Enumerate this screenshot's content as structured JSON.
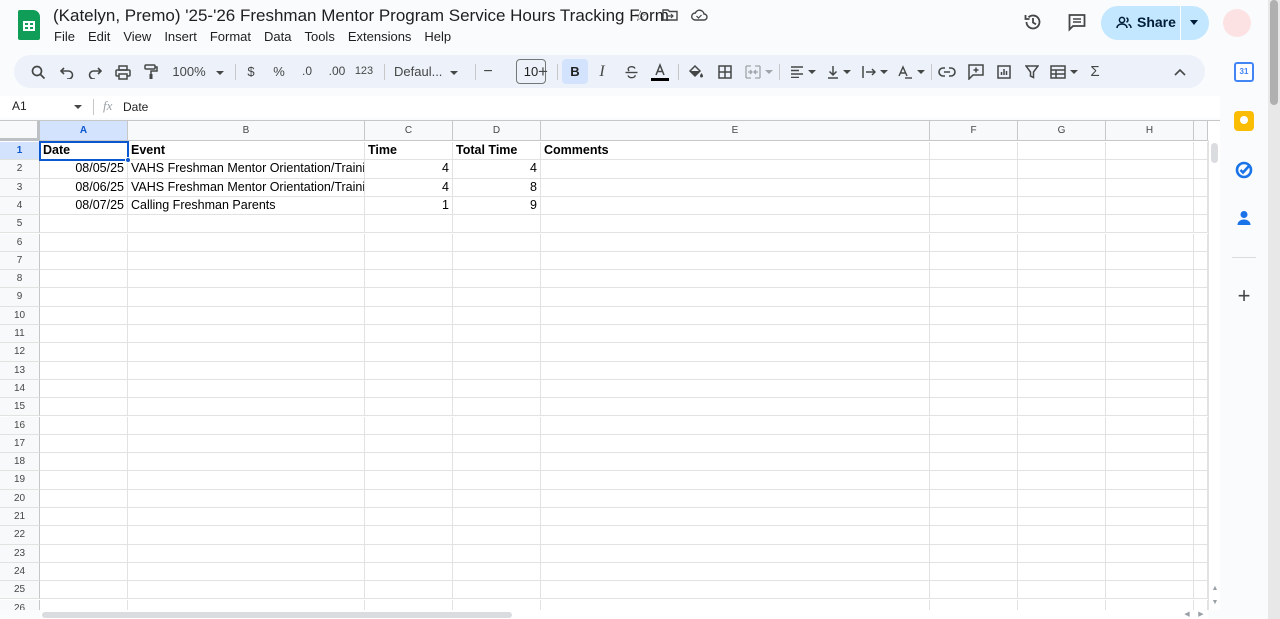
{
  "document": {
    "title": "(Katelyn, Premo) '25-'26 Freshman Mentor Program Service Hours Tracking Form"
  },
  "menu": [
    "File",
    "Edit",
    "View",
    "Insert",
    "Format",
    "Data",
    "Tools",
    "Extensions",
    "Help"
  ],
  "header": {
    "share_label": "Share"
  },
  "toolbar": {
    "zoom": "100%",
    "currency": "$",
    "percent": "%",
    "decrease_decimals": ".0",
    "increase_decimals": ".00",
    "number_format": "123",
    "font": "Defaul...",
    "font_size": "10",
    "minus": "−",
    "plus": "+",
    "bold": "B",
    "italic": "I",
    "sum": "Σ"
  },
  "formula_bar": {
    "cell_ref": "A1",
    "fx": "fx",
    "value": "Date"
  },
  "sheet": {
    "columns": [
      "A",
      "B",
      "C",
      "D",
      "E",
      "F",
      "G",
      "H"
    ],
    "row_numbers": [
      "1",
      "2",
      "3",
      "4",
      "5",
      "6",
      "7",
      "8",
      "9",
      "10",
      "11",
      "12",
      "13",
      "14",
      "15",
      "16",
      "17",
      "18",
      "19",
      "20",
      "21",
      "22",
      "23",
      "24",
      "25",
      "26"
    ],
    "headers": [
      "Date",
      "Event",
      "Time",
      "Total Time",
      "Comments"
    ],
    "rows": [
      {
        "date": "08/05/25",
        "event": "VAHS Freshman Mentor Orientation/Training",
        "time": "4",
        "total": "4",
        "comments": ""
      },
      {
        "date": "08/06/25",
        "event": "VAHS Freshman Mentor Orientation/Training",
        "time": "4",
        "total": "8",
        "comments": ""
      },
      {
        "date": "08/07/25",
        "event": "Calling Freshman Parents",
        "time": "1",
        "total": "9",
        "comments": ""
      }
    ]
  },
  "side_panel": {
    "calendar_day": "31"
  }
}
